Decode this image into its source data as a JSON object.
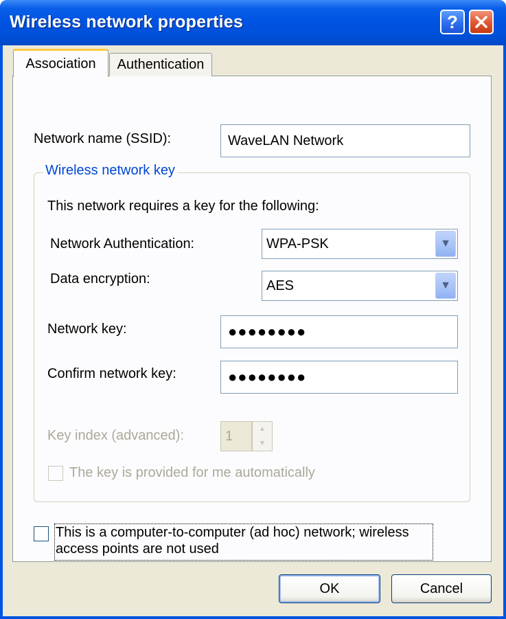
{
  "window": {
    "title": "Wireless network properties"
  },
  "tabs": [
    {
      "label": "Association",
      "selected": true
    },
    {
      "label": "Authentication",
      "selected": false
    }
  ],
  "association": {
    "ssid_label": "Network name (SSID):",
    "ssid_value": "WaveLAN Network",
    "key_group": {
      "title": "Wireless network key",
      "requires_text": "This network requires a key for the following:",
      "auth_label": "Network Authentication:",
      "auth_value": "WPA-PSK",
      "encryption_label": "Data encryption:",
      "encryption_value": "AES",
      "network_key_label": "Network key:",
      "network_key_value": "●●●●●●●●",
      "confirm_key_label": "Confirm network key:",
      "confirm_key_value": "●●●●●●●●",
      "key_index_label": "Key index (advanced):",
      "key_index_value": "1",
      "auto_key_label": "The key is provided for me automatically"
    },
    "adhoc_label_line1": "This is a computer-to-computer (ad hoc) network; wireless",
    "adhoc_label_line2": "access points are not used"
  },
  "buttons": {
    "ok": "OK",
    "cancel": "Cancel"
  }
}
